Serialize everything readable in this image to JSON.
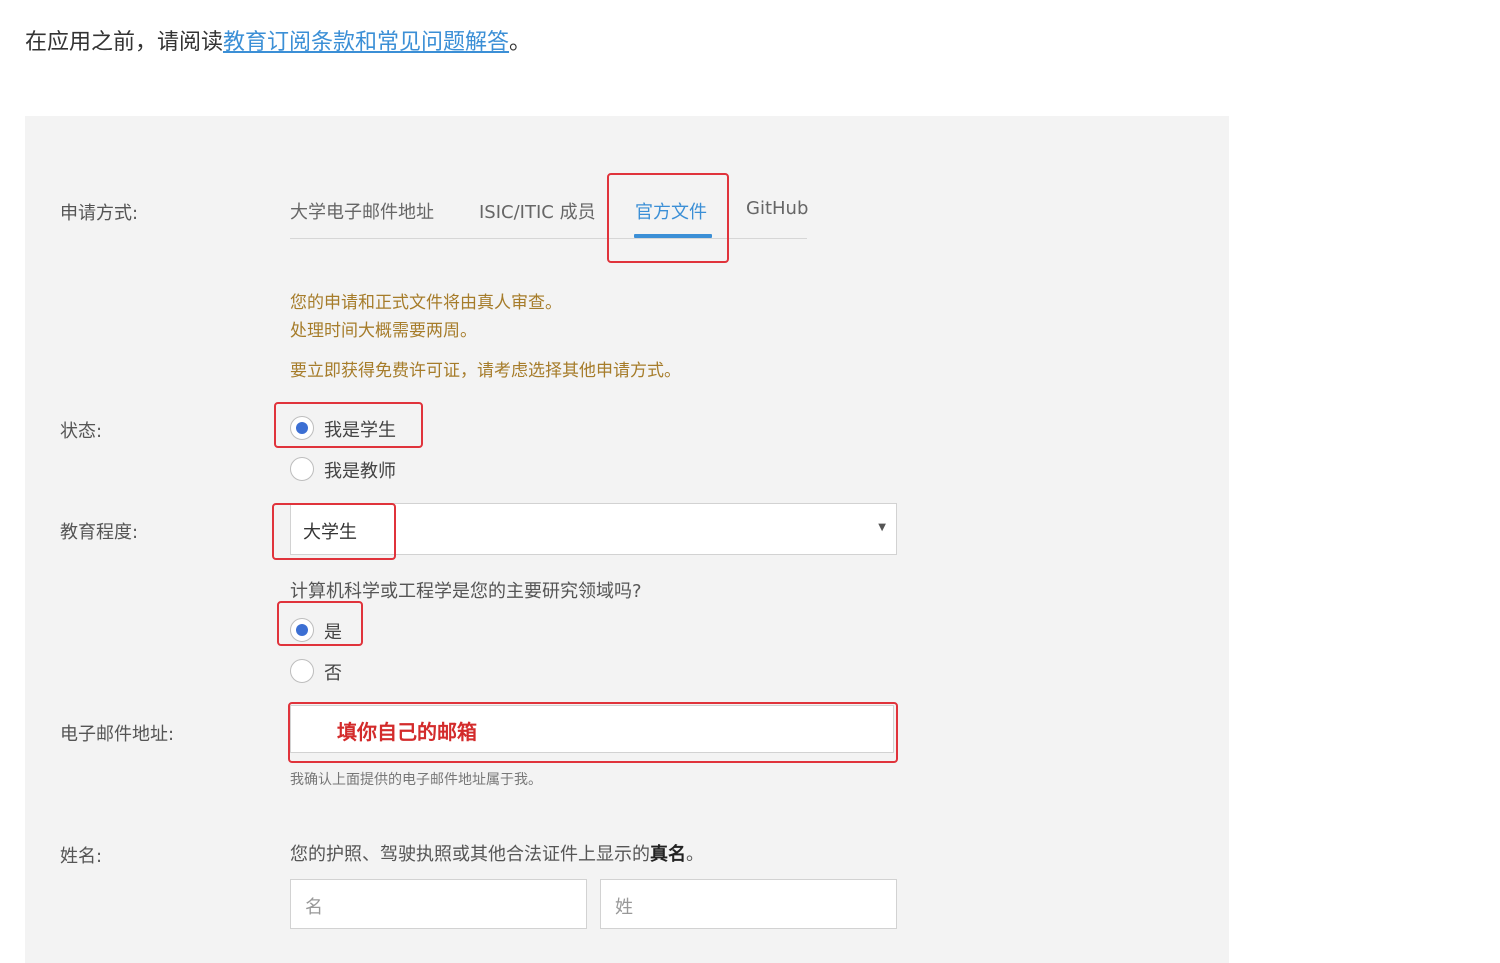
{
  "intro": {
    "prefix": "在应用之前，请阅读",
    "link": "教育订阅条款和常见问题解答",
    "suffix": "。"
  },
  "form": {
    "method_label": "申请方式:",
    "tabs": [
      "大学电子邮件地址",
      "ISIC/ITIC 成员",
      "官方文件",
      "GitHub"
    ],
    "active_tab": "官方文件",
    "notice": {
      "line1": "您的申请和正式文件将由真人审查。",
      "line2": "处理时间大概需要两周。",
      "line3": "要立即获得免费许可证，请考虑选择其他申请方式。"
    },
    "status_label": "状态:",
    "status_options": [
      {
        "label": "我是学生",
        "checked": true
      },
      {
        "label": "我是教师",
        "checked": false
      }
    ],
    "education_label": "教育程度:",
    "education_value": "大学生",
    "cs_question": "计算机科学或工程学是您的主要研究领域吗?",
    "cs_options": [
      {
        "label": "是",
        "checked": true
      },
      {
        "label": "否",
        "checked": false
      }
    ],
    "email_label": "电子邮件地址:",
    "email_annotation": "填你自己的邮箱",
    "email_hint": "我确认上面提供的电子邮件地址属于我。",
    "name_label": "姓名:",
    "name_desc_prefix": "您的护照、驾驶执照或其他合法证件上显示的",
    "name_desc_bold": "真名",
    "name_desc_suffix": "。",
    "first_name_placeholder": "名",
    "last_name_placeholder": "姓"
  },
  "colors": {
    "accent": "#3b8fd6",
    "notice": "#a67c2a",
    "annotation": "#e0333b",
    "radio_checked": "#3c6fd3"
  }
}
